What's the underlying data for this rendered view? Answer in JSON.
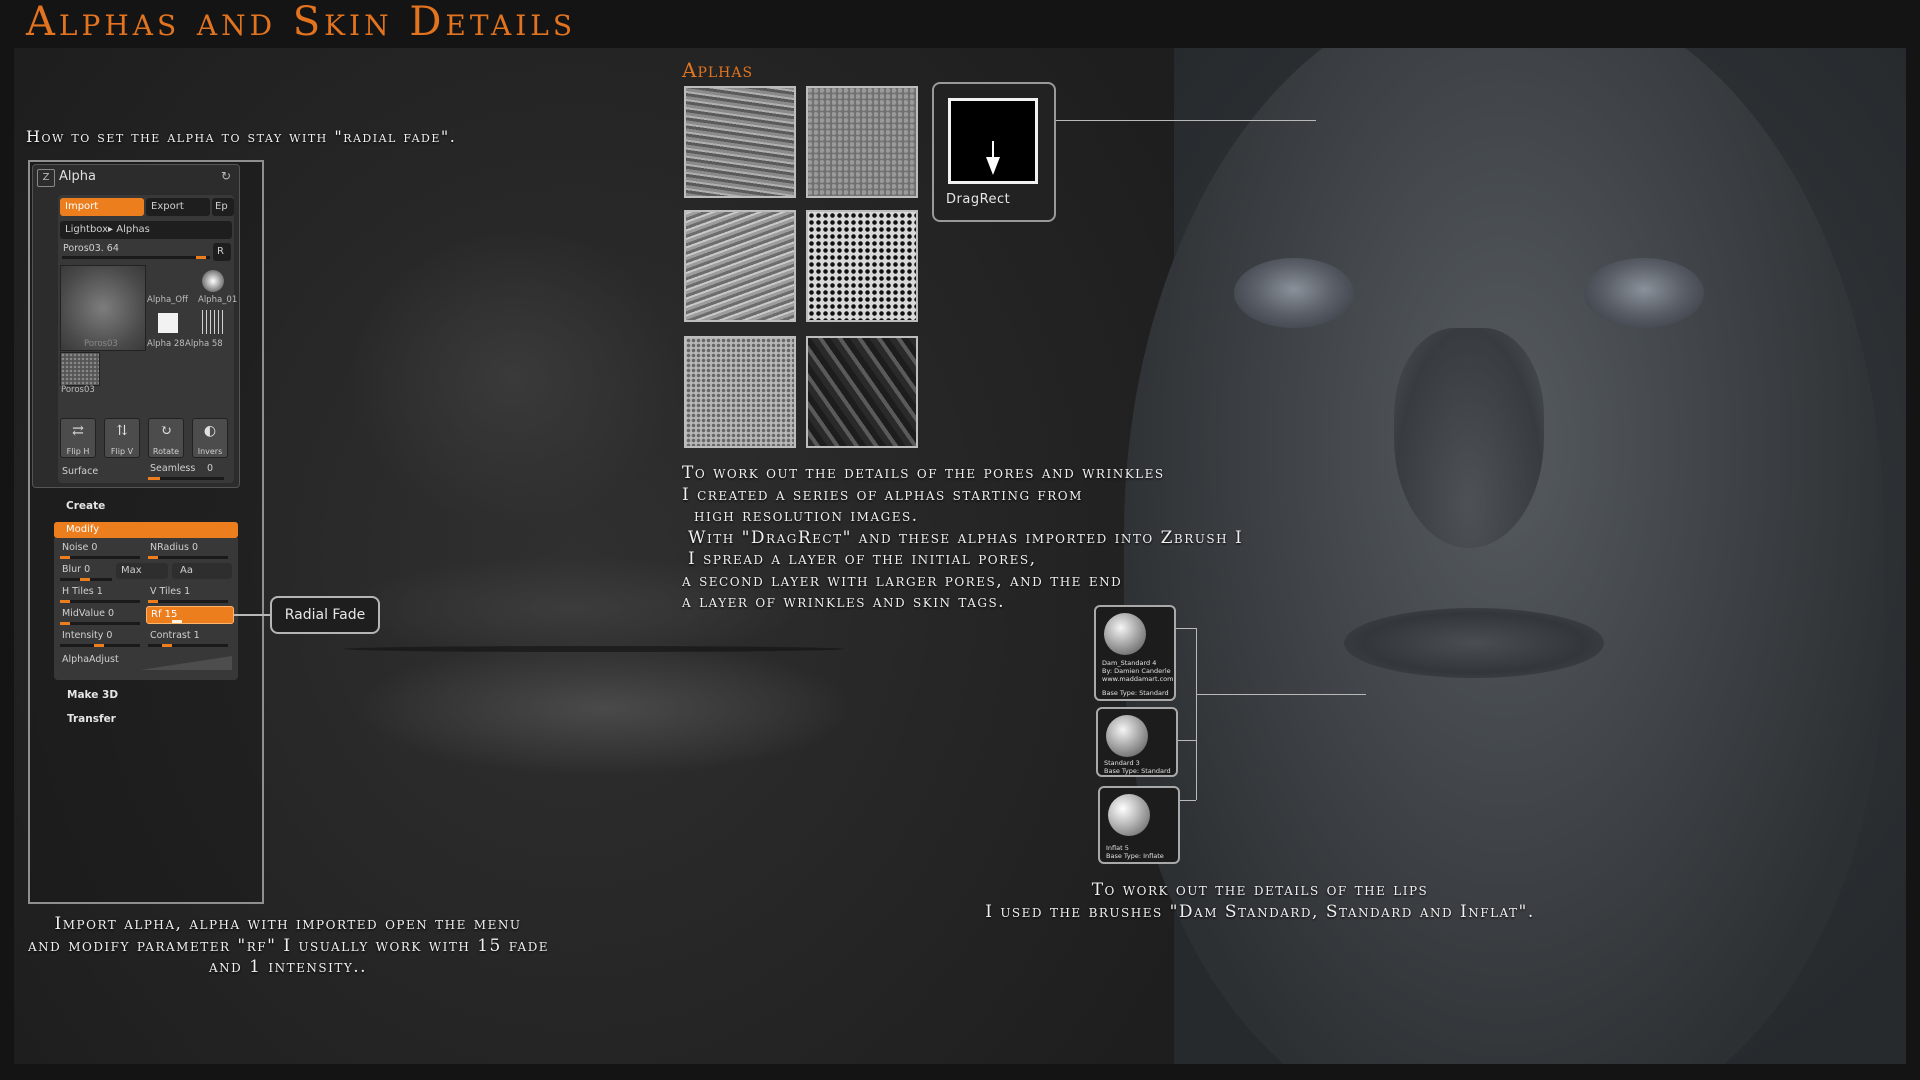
{
  "title": "Alphas and Skin Details",
  "captions": {
    "radial_fade_howto": "How to set the alpha to stay with \"radial fade\".",
    "import_steps": [
      "Import alpha, alpha with imported open the menu",
      "and modify parameter \"rf\" I usually work with 15 fade",
      "and 1 intensity.."
    ],
    "pores_process": [
      "To work out the details of the pores and wrinkles",
      "I created a series of alphas starting from",
      "high resolution images.",
      "With \"DragRect\" and these alphas imported into Zbrush I",
      "I spread a layer of the initial pores,",
      "a second layer with larger pores, and the end",
      "a layer of wrinkles and skin tags."
    ],
    "lips_brushes": [
      "To work out the details of the lips",
      "I used the brushes \"Dam Standard, Standard and Inflat\"."
    ]
  },
  "alphas_heading": "Aplhas",
  "dragrect": {
    "label": "DragRect"
  },
  "alpha_palette": {
    "title": "Alpha",
    "import_label": "Import",
    "export_label": "Export",
    "ep_label": "Ep",
    "breadcrumb": "Lightbox▸ Alphas",
    "current_alpha": "Poros03. 64",
    "r_label": "R",
    "thumbnails": {
      "main_caption": "Poros03",
      "alpha_off": "Alpha_Off",
      "alpha_01": "Alpha_01",
      "alpha_28": "Alpha 28",
      "alpha_58": "Alpha 58",
      "small_caption": "Poros03"
    },
    "tools": [
      "Flip H",
      "Flip V",
      "Rotate",
      "Invers"
    ],
    "surface_label": "Surface",
    "seamless_label": "Seamless",
    "seamless_value": "0",
    "create_label": "Create",
    "modify_label": "Modify",
    "params": {
      "noise": "Noise 0",
      "nradius": "NRadius 0",
      "blur": "Blur 0",
      "max": "Max",
      "aa": "Aa",
      "htiles": "H Tiles 1",
      "vtiles": "V Tiles 1",
      "midvalue": "MidValue 0",
      "rf": "Rf 15",
      "intensity": "Intensity 0",
      "contrast": "Contrast 1",
      "alpha_adjust": "AlphaAdjust"
    },
    "make3d_label": "Make 3D",
    "transfer_label": "Transfer"
  },
  "radial_fade_callout": "Radial Fade",
  "brushes": [
    {
      "name": "Dam_Standard  4",
      "author": "By: Damien Canderle",
      "site": "www.maddamart.com",
      "base": "Base Type: Standard"
    },
    {
      "name": "Standard  3",
      "base": "Base Type: Standard"
    },
    {
      "name": "Inflat  5",
      "base": "Base Type: Inflate"
    }
  ],
  "colors": {
    "accent": "#e2731f",
    "ui_orange": "#ed7e1e",
    "text": "#f0f0f0"
  },
  "icons": {
    "dragrect": "down-arrow-icon",
    "palette": "zbrush-logo-icon",
    "refresh": "refresh-icon"
  }
}
